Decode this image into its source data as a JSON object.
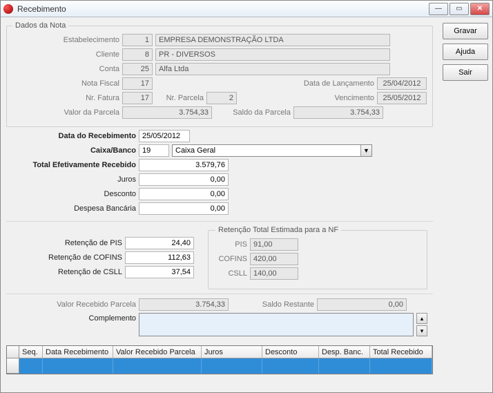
{
  "window": {
    "title": "Recebimento"
  },
  "sidebar": {
    "gravar": "Gravar",
    "ajuda": "Ajuda",
    "sair": "Sair"
  },
  "groups": {
    "dados_nota": "Dados da Nota",
    "retencao_total": "Retenção Total Estimada para a NF"
  },
  "labels": {
    "estabelecimento": "Estabelecimento",
    "cliente": "Cliente",
    "conta": "Conta",
    "nota_fiscal": "Nota Fiscal",
    "data_lancamento": "Data de Lançamento",
    "nr_fatura": "Nr. Fatura",
    "nr_parcela": "Nr. Parcela",
    "vencimento": "Vencimento",
    "valor_parcela": "Valor da Parcela",
    "saldo_parcela": "Saldo da Parcela",
    "data_recebimento": "Data do Recebimento",
    "caixa_banco": "Caixa/Banco",
    "total_efetivo": "Total Efetivamente Recebido",
    "juros": "Juros",
    "desconto": "Desconto",
    "despesa_banc": "Despesa Bancária",
    "ret_pis": "Retenção de PIS",
    "ret_cofins": "Retenção de COFINS",
    "ret_csll": "Retenção de CSLL",
    "pis": "PIS",
    "cofins": "COFINS",
    "csll": "CSLL",
    "valor_receb_parcela": "Valor Recebido Parcela",
    "saldo_restante": "Saldo Restante",
    "complemento": "Complemento"
  },
  "fields": {
    "estabelecimento_code": "1",
    "estabelecimento_desc": "EMPRESA DEMONSTRAÇÃO LTDA",
    "cliente_code": "8",
    "cliente_desc": "PR - DIVERSOS",
    "conta_code": "25",
    "conta_desc": "Alfa Ltda",
    "nota_fiscal": "17",
    "data_lancamento": "25/04/2012",
    "nr_fatura": "17",
    "nr_parcela": "2",
    "vencimento": "25/05/2012",
    "valor_parcela": "3.754,33",
    "saldo_parcela": "3.754,33",
    "data_recebimento": "25/05/2012",
    "caixa_code": "19",
    "caixa_desc": "Caixa Geral",
    "total_efetivo": "3.579,76",
    "juros": "0,00",
    "desconto": "0,00",
    "despesa_banc": "0,00",
    "ret_pis": "24,40",
    "ret_cofins": "112,63",
    "ret_csll": "37,54",
    "est_pis": "91,00",
    "est_cofins": "420,00",
    "est_csll": "140,00",
    "valor_receb_parcela": "3.754,33",
    "saldo_restante": "0,00",
    "complemento": ""
  },
  "table": {
    "headers": {
      "seq": "Seq.",
      "data_receb": "Data Recebimento",
      "valor_receb": "Valor Recebido Parcela",
      "juros": "Juros",
      "desconto": "Desconto",
      "desp_banc": "Desp. Banc.",
      "total_receb": "Total Recebido"
    }
  }
}
